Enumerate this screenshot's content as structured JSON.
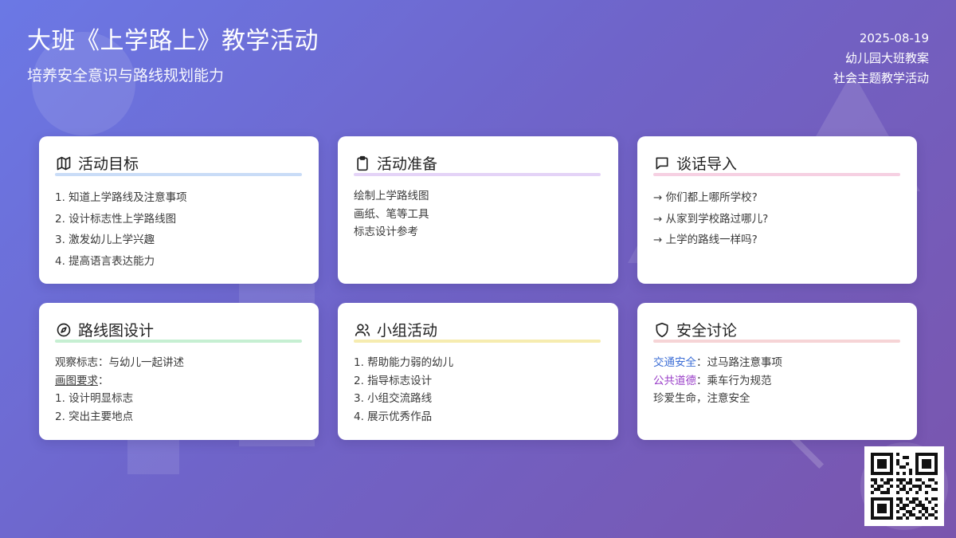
{
  "header": {
    "title": "大班《上学路上》教学活动",
    "subtitle": "培养安全意识与路线规划能力",
    "date": "2025-08-19",
    "meta1": "幼儿园大班教案",
    "meta2": "社会主题教学活动"
  },
  "cards": {
    "goals": {
      "icon": "map-icon",
      "title": "活动目标",
      "items": [
        "1. 知道上学路线及注意事项",
        "2. 设计标志性上学路线图",
        "3. 激发幼儿上学兴趣",
        "4. 提高语言表达能力"
      ]
    },
    "prep": {
      "icon": "clipboard-icon",
      "title": "活动准备",
      "items": [
        "绘制上学路线图",
        "画纸、笔等工具",
        "标志设计参考"
      ]
    },
    "intro": {
      "icon": "chat-icon",
      "title": "谈话导入",
      "items": [
        "→ 你们都上哪所学校?",
        "→ 从家到学校路过哪儿?",
        "→ 上学的路线一样吗?"
      ]
    },
    "design": {
      "icon": "compass-icon",
      "title": "路线图设计",
      "line1": "观察标志：与幼儿一起讲述",
      "req_label": "画图要求",
      "req_suffix": "：",
      "items": [
        "1. 设计明显标志",
        "2. 突出主要地点"
      ]
    },
    "group": {
      "icon": "users-icon",
      "title": "小组活动",
      "items": [
        "1. 帮助能力弱的幼儿",
        "2. 指导标志设计",
        "3. 小组交流路线",
        "4. 展示优秀作品"
      ]
    },
    "safety": {
      "icon": "shield-icon",
      "title": "安全讨论",
      "kw1": "交通安全",
      "rest1": "：过马路注意事项",
      "kw2": "公共道德",
      "rest2": "：乘车行为规范",
      "line3": "珍爱生命，注意安全"
    }
  },
  "colors": {
    "keyword_blue": "#3e6fd6",
    "keyword_purple": "#9a3fc8"
  },
  "qr": {
    "icon": "qr-code-icon"
  }
}
